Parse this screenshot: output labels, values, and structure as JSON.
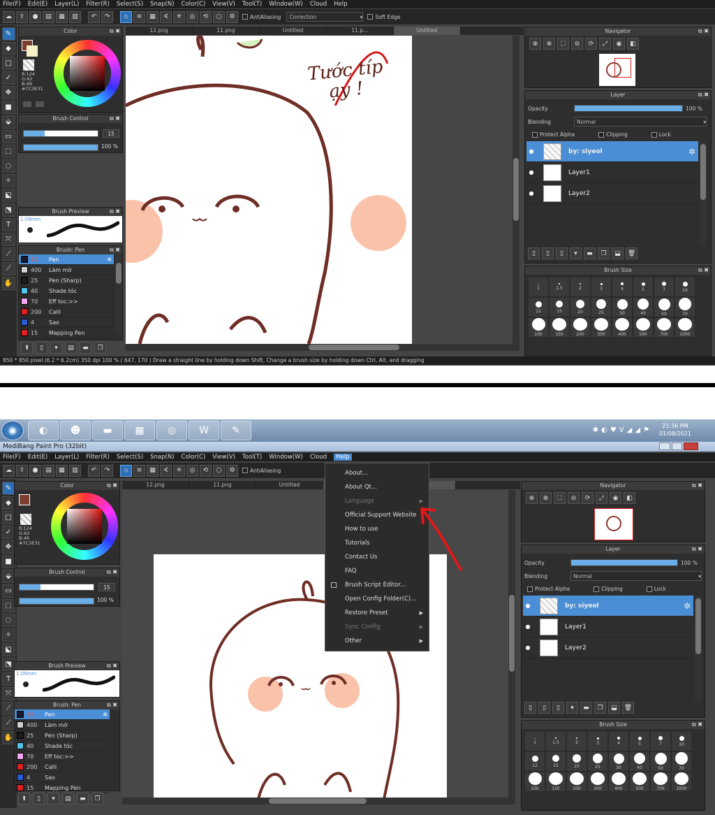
{
  "menu": [
    "File(F)",
    "Edit(E)",
    "Layer(L)",
    "Filter(R)",
    "Select(S)",
    "Snap(N)",
    "Color(C)",
    "View(V)",
    "Tool(T)",
    "Window(W)",
    "Cloud",
    "Help"
  ],
  "toolbar": {
    "antialiasing_label": "AntiAliasing",
    "correction_label": "Correction",
    "soft_edge_label": "Soft Edge"
  },
  "color_panel": {
    "title": "Color",
    "r": "R:124",
    "g": "G:62",
    "b": "B:49",
    "hex": "#7C3E31",
    "accent": "#7C3E31"
  },
  "brush_control": {
    "title": "Brush Control",
    "size_value": "15",
    "opacity_value": "100 %"
  },
  "brush_preview": {
    "title": "Brush Preview",
    "size_label": "1.09mm"
  },
  "brush_list": {
    "title": "Brush: Pen",
    "items": [
      {
        "size": "15",
        "name": "Pen",
        "color": "#1a1a2a"
      },
      {
        "size": "400",
        "name": "Làm mờ",
        "color": "#d0d0d0"
      },
      {
        "size": "25",
        "name": "Pen (Sharp)",
        "color": "#1a1a1a"
      },
      {
        "size": "40",
        "name": "Shade tóc",
        "color": "#4fc3e8"
      },
      {
        "size": "70",
        "name": "Eff toc:>>",
        "color": "#f2a6f0"
      },
      {
        "size": "200",
        "name": "Calli",
        "color": "#e02020"
      },
      {
        "size": "4",
        "name": "Sao",
        "color": "#2a5ad6"
      },
      {
        "size": "15",
        "name": "Mapping Pen",
        "color": "#e02020"
      }
    ]
  },
  "tabs": [
    "12.png",
    "11.png",
    "Untitled",
    "11.p…",
    "Untitled"
  ],
  "tabs_bottom": [
    "12.png",
    "11.png",
    "Untitled"
  ],
  "annotation": {
    "line1": "Tước típ",
    "line2": "ạy !"
  },
  "navigator": {
    "title": "Navigator"
  },
  "layer_panel": {
    "title": "Layer",
    "opacity_label": "Opacity",
    "opacity_value": "100 %",
    "blending_label": "Blending",
    "blending_value": "Normal",
    "protect_alpha": "Protect Alpha",
    "clipping": "Clipping",
    "lock": "Lock",
    "layers": [
      {
        "name": "by: siyeol"
      },
      {
        "name": "Layer1"
      },
      {
        "name": "Layer2"
      }
    ]
  },
  "brush_size": {
    "title": "Brush Size",
    "sizes": [
      "1",
      "1.5",
      "2",
      "3",
      "4",
      "5",
      "7",
      "10",
      "12",
      "15",
      "20",
      "25",
      "30",
      "40",
      "50",
      "70",
      "100",
      "150",
      "200",
      "300",
      "400",
      "500",
      "700",
      "1000"
    ]
  },
  "status": "850 * 850 pixel  (6.2 * 6.2cm)  350 dpi  100 %  ( 647, 170 )  Draw a straight line by holding down Shift, Change a brush size by holding down Ctrl, Alt, and dragging",
  "window_title": "MediBang Paint Pro (32bit)",
  "clock": {
    "time": "21:36 PM",
    "date": "01/08/2021"
  },
  "help_menu": [
    {
      "label": "About..."
    },
    {
      "label": "About Qt..."
    },
    {
      "label": "Language",
      "disabled": true,
      "submenu": true
    },
    {
      "label": "Official Support Website"
    },
    {
      "label": "How to use"
    },
    {
      "label": "Tutorials"
    },
    {
      "label": "Contact Us"
    },
    {
      "label": "FAQ"
    },
    {
      "label": "Brush Script Editor...",
      "checkbox": true
    },
    {
      "label": "Open Config Folder(C)..."
    },
    {
      "label": "Restore Preset",
      "submenu": true
    },
    {
      "label": "Sync Config",
      "disabled": true,
      "submenu": true
    },
    {
      "label": "Other",
      "submenu": true
    }
  ]
}
